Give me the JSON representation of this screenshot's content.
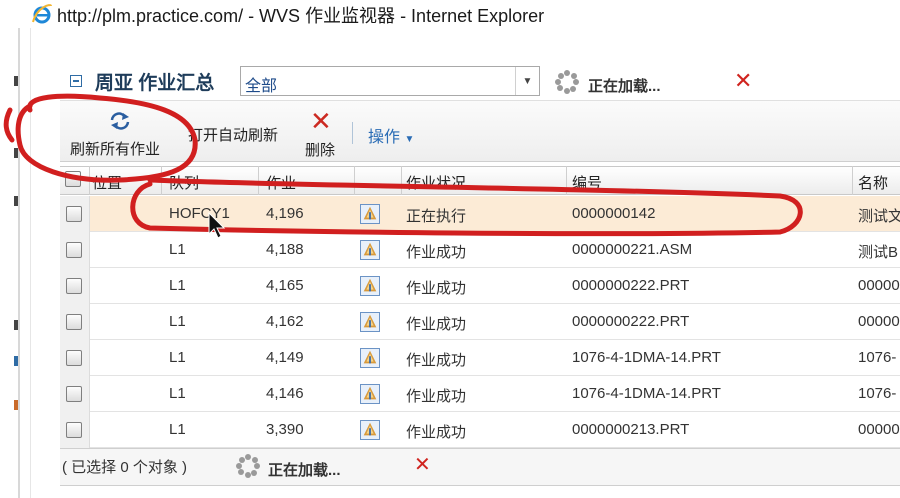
{
  "window": {
    "title": "http://plm.practice.com/ - WVS 作业监视器 - Internet Explorer"
  },
  "panel": {
    "title": "周亚 作业汇总",
    "filter_value": "全部",
    "loading_text": "正在加载..."
  },
  "toolbar": {
    "refresh_all_label": "刷新所有作业",
    "auto_refresh_label": "打开自动刷新",
    "delete_label": "删除",
    "actions_label": "操作"
  },
  "table": {
    "columns": [
      "位置",
      "队列",
      "作业",
      "",
      "作业状况",
      "编号",
      "名称"
    ],
    "rows": [
      {
        "queue": "HOFCY1",
        "job": "4,196",
        "status": "正在执行",
        "number": "0000000142",
        "name": "测试文",
        "selected": true
      },
      {
        "queue": "L1",
        "job": "4,188",
        "status": "作业成功",
        "number": "0000000221.ASM",
        "name": "测试B"
      },
      {
        "queue": "L1",
        "job": "4,165",
        "status": "作业成功",
        "number": "0000000222.PRT",
        "name": "00000"
      },
      {
        "queue": "L1",
        "job": "4,162",
        "status": "作业成功",
        "number": "0000000222.PRT",
        "name": "00000"
      },
      {
        "queue": "L1",
        "job": "4,149",
        "status": "作业成功",
        "number": "1076-4-1DMA-14.PRT",
        "name": "1076-"
      },
      {
        "queue": "L1",
        "job": "4,146",
        "status": "作业成功",
        "number": "1076-4-1DMA-14.PRT",
        "name": "1076-"
      },
      {
        "queue": "L1",
        "job": "3,390",
        "status": "作业成功",
        "number": "0000000213.PRT",
        "name": "00000"
      }
    ]
  },
  "footer": {
    "selection_text": "( 已选择 0 个对象 )",
    "loading_text": "正在加载..."
  },
  "colors": {
    "annotation": "#d11f1f",
    "selected_row": "#fcebd6",
    "link_blue": "#2a6cb5"
  }
}
